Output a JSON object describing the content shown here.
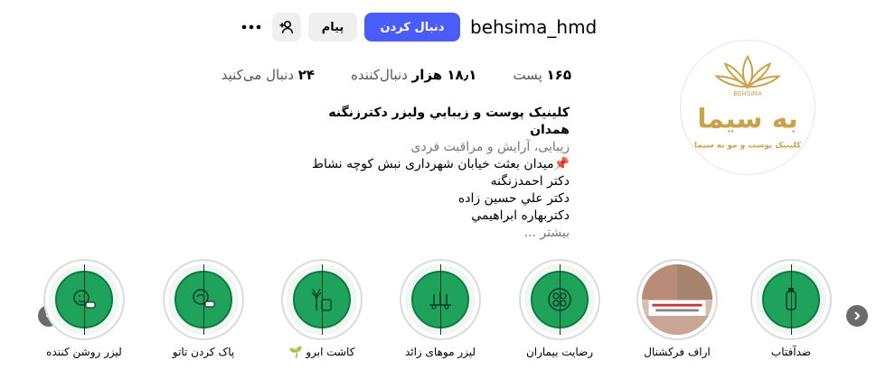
{
  "profile": {
    "username": "behsima_hmd",
    "avatar_text": "به سیما",
    "avatar_subtext": "کلینیک پوست و مو به سیما",
    "avatar_brand": "BEHSIMA"
  },
  "actions": {
    "follow_label": "دنبال کردن",
    "message_label": "پیام",
    "add_user_icon": "add-user-icon",
    "more_icon": "more-icon"
  },
  "stats": {
    "posts_value": "۱۶۵",
    "posts_label": "پست",
    "followers_value": "۱۸٫۱ هزار",
    "followers_label": "دنبال‌کننده",
    "following_value": "۲۴",
    "following_label": "دنبال می‌کنید"
  },
  "bio": {
    "name": "کلینیک پوست و زيبايي وليزر دکترزنگنه همدان",
    "category": "زیبایی، آرایش و مراقبت فردی",
    "lines": [
      "📌میدان بعثت خیابان شهرداری نبش کوچه نشاط",
      "دکتر احمدزنگنه",
      "دكتر علي حسين زاده",
      "دكتربهاره ابراهيمي"
    ],
    "more": "بیشتر ..."
  },
  "highlights": [
    {
      "label": "ضدآفتاب",
      "icon": "sunscreen-icon"
    },
    {
      "label": "اراف فرکشنال",
      "icon": "photo-thumbnail"
    },
    {
      "label": "رضایت بیماران",
      "icon": "satisfaction-icon"
    },
    {
      "label": "لیزر موهای زائد",
      "icon": "hair-removal-icon"
    },
    {
      "label": "کاشت ابرو 🌱",
      "icon": "eyebrow-icon"
    },
    {
      "label": "پاک کردن تاتو",
      "icon": "tattoo-removal-icon"
    },
    {
      "label": "لیزر روشن کننده",
      "icon": "laser-brightening-icon"
    }
  ],
  "colors": {
    "accent": "#4a5df9",
    "highlight_green": "#1fa35c",
    "gold": "#c9a24a"
  }
}
